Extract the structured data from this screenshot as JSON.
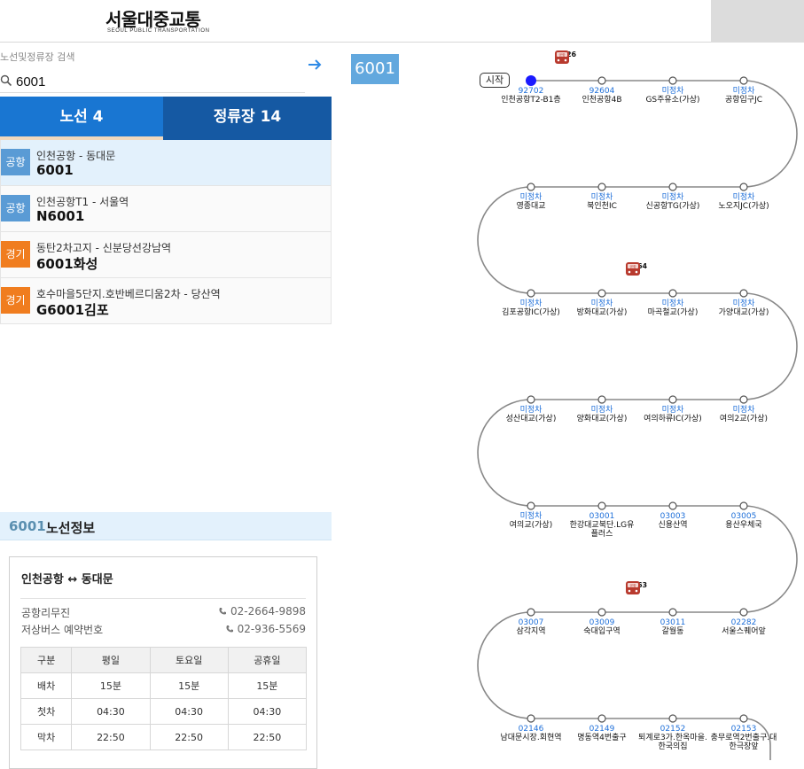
{
  "header": {
    "title": "서울대중교통",
    "subtitle": "SEOUL PUBLIC TRANSPORTATION"
  },
  "search": {
    "label": "노선및정류장 검색",
    "value": "6001"
  },
  "tabs": [
    {
      "label": "노선",
      "count": "4"
    },
    {
      "label": "정류장",
      "count": "14"
    }
  ],
  "routes": [
    {
      "badge": "공항",
      "desc": "인천공항 - 동대문",
      "number": "6001",
      "type": "air"
    },
    {
      "badge": "공항",
      "desc": "인천공항T1 - 서울역",
      "number": "N6001",
      "type": "air"
    },
    {
      "badge": "경기",
      "desc": "동탄2차고지 - 신분당선강남역",
      "number": "6001화성",
      "type": "gg"
    },
    {
      "badge": "경기",
      "desc": "호수마을5단지.호반베르디움2차 - 당산역",
      "number": "G6001김포",
      "type": "gg"
    }
  ],
  "info": {
    "route_number": "6001",
    "title": "노선정보",
    "terminals": "인천공항 ↔ 동대문",
    "company": "공항리무진",
    "company_phone": "02-2664-9898",
    "reserve_label": "저상버스 예약번호",
    "reserve_phone": "02-936-5569",
    "schedule_headers": [
      "구분",
      "평일",
      "토요일",
      "공휴일"
    ],
    "schedule_rows": [
      [
        "배차",
        "15분",
        "15분",
        "15분"
      ],
      [
        "첫차",
        "04:30",
        "04:30",
        "04:30"
      ],
      [
        "막차",
        "22:50",
        "22:50",
        "22:50"
      ]
    ]
  },
  "route_tag": "6001",
  "map": {
    "start_label": "시작",
    "bus_icon_label": "공항",
    "line_color": "#888888",
    "current_stop_color": "#1a1aff",
    "buses": [
      {
        "number": "2426"
      },
      {
        "number": "2364"
      },
      {
        "number": "2363"
      }
    ],
    "rows": [
      [
        {
          "id": "92702",
          "name": "인천공항T2-B1층"
        },
        {
          "id": "92604",
          "name": "인천공항4B"
        },
        {
          "id": "미정차",
          "name": "GS주유소(가상)"
        },
        {
          "id": "미정차",
          "name": "공항입구JC"
        }
      ],
      [
        {
          "id": "미정차",
          "name": "노오지JC(가상)"
        },
        {
          "id": "미정차",
          "name": "신공항TG(가상)"
        },
        {
          "id": "미정차",
          "name": "북인천IC"
        },
        {
          "id": "미정차",
          "name": "영종대교"
        }
      ],
      [
        {
          "id": "미정차",
          "name": "김포공항IC(가상)"
        },
        {
          "id": "미정차",
          "name": "방화대교(가상)"
        },
        {
          "id": "미정차",
          "name": "마곡철교(가상)"
        },
        {
          "id": "미정차",
          "name": "가양대교(가상)"
        }
      ],
      [
        {
          "id": "미정차",
          "name": "여의2교(가상)"
        },
        {
          "id": "미정차",
          "name": "여의하류IC(가상)"
        },
        {
          "id": "미정차",
          "name": "양화대교(가상)"
        },
        {
          "id": "미정차",
          "name": "성산대교(가상)"
        }
      ],
      [
        {
          "id": "미정차",
          "name": "여의교(가상)"
        },
        {
          "id": "03001",
          "name": "한강대교북단.LG유플러스"
        },
        {
          "id": "03003",
          "name": "신용산역"
        },
        {
          "id": "03005",
          "name": "용산우체국"
        }
      ],
      [
        {
          "id": "02282",
          "name": "서울스퀘어앞"
        },
        {
          "id": "03011",
          "name": "갈월동"
        },
        {
          "id": "03009",
          "name": "숙대입구역"
        },
        {
          "id": "03007",
          "name": "삼각지역"
        }
      ],
      [
        {
          "id": "02146",
          "name": "남대문시장.회현역"
        },
        {
          "id": "02149",
          "name": "명동역4번출구"
        },
        {
          "id": "02152",
          "name": "퇴계로3가.한옥마을.한국의집"
        },
        {
          "id": "02153",
          "name": "충무로역2번출구.대한극장앞"
        }
      ]
    ]
  }
}
